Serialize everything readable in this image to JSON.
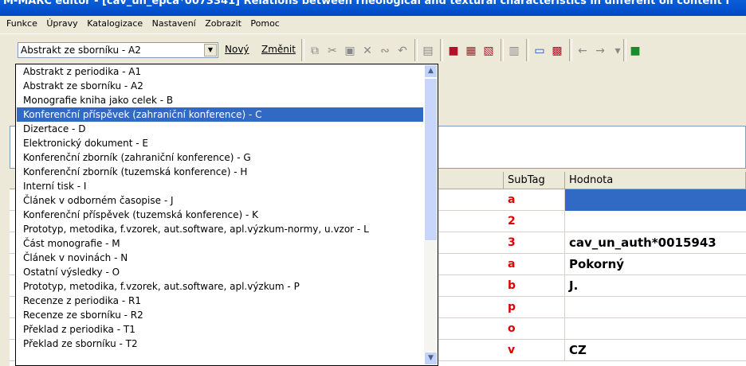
{
  "window": {
    "title": "M-MARC editor - [cav_un_epca*0073341] Relations between rheological and textural characteristics in different oil content f"
  },
  "menu": [
    "Funkce",
    "Úpravy",
    "Katalogizace",
    "Nastavení",
    "Zobrazit",
    "Pomoc"
  ],
  "toolbar": {
    "record_type_value": "Abstrakt ze sborníku - A2",
    "new_label": "Nový",
    "change_label": "Změnit"
  },
  "record_type_options": [
    "Abstrakt z periodika - A1",
    "Abstrakt ze sborníku - A2",
    "Monografie kniha jako celek - B",
    "Konferenční příspěvek (zahraniční konference) - C",
    "Dizertace - D",
    "Elektronický dokument - E",
    "Konferenční zborník (zahraniční konference) - G",
    "Konferenční zborník (tuzemská konference) - H",
    "Interní tisk - I",
    "Článek v odborném časopise - J",
    "Konferenční příspěvek (tuzemská konference) - K",
    "Prototyp, metodika, f.vzorek, aut.software, apl.výzkum-normy, u.vzor - L",
    "Část monografie - M",
    "Článek v novinách - N",
    "Ostatní výsledky - O",
    "Prototyp, metodika, f.vzorek, aut.software, apl.výzkum - P",
    "Recenze z periodika - R1",
    "Recenze ze sborníku - R2",
    "Překlad z periodika - T1",
    "Překlad ze sborníku - T2"
  ],
  "record_type_selected_index": 3,
  "grid": {
    "headers": {
      "subtag": "SubTag",
      "value": "Hodnota"
    },
    "rows": [
      {
        "subtag": "a",
        "value": ""
      },
      {
        "subtag": "2",
        "value": ""
      },
      {
        "subtag": "3",
        "value": "cav_un_auth*0015943"
      },
      {
        "subtag": "a",
        "value": "Pokorný"
      },
      {
        "subtag": "b",
        "value": "J."
      },
      {
        "subtag": "p",
        "value": ""
      },
      {
        "subtag": "o",
        "value": ""
      },
      {
        "subtag": "v",
        "value": "CZ"
      }
    ]
  }
}
